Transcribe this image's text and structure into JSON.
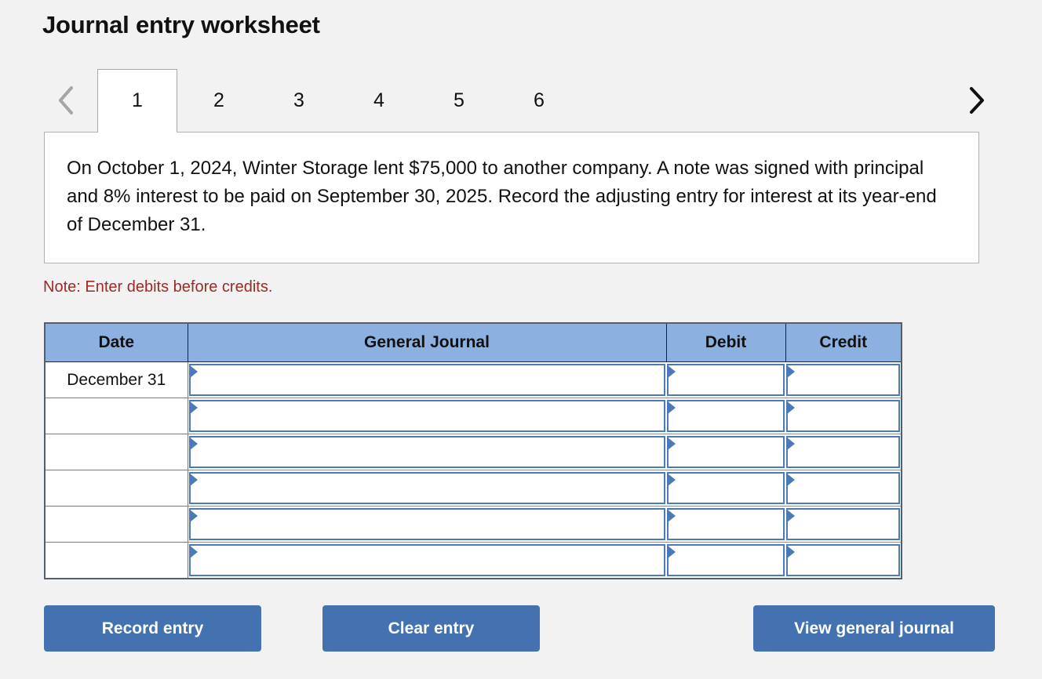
{
  "page": {
    "title": "Journal entry worksheet"
  },
  "tabs": {
    "prev_icon": "chevron-left-icon",
    "next_icon": "chevron-right-icon",
    "items": [
      {
        "label": "1",
        "active": true
      },
      {
        "label": "2",
        "active": false
      },
      {
        "label": "3",
        "active": false
      },
      {
        "label": "4",
        "active": false
      },
      {
        "label": "5",
        "active": false
      },
      {
        "label": "6",
        "active": false
      }
    ]
  },
  "question": {
    "text": "On October 1, 2024, Winter Storage lent $75,000 to another company. A note was signed with principal and 8% interest to be paid on September 30, 2025. Record the adjusting entry for interest at its year-end of December 31."
  },
  "note": {
    "text": "Note: Enter debits before credits.",
    "color": "#9d2a24"
  },
  "table": {
    "headers": [
      "Date",
      "General Journal",
      "Debit",
      "Credit"
    ],
    "header_bg": "#8cb0e0",
    "field_border": "#4a7ab8",
    "rows": [
      {
        "date": "December 31",
        "general_journal": "",
        "debit": "",
        "credit": ""
      },
      {
        "date": "",
        "general_journal": "",
        "debit": "",
        "credit": ""
      },
      {
        "date": "",
        "general_journal": "",
        "debit": "",
        "credit": ""
      },
      {
        "date": "",
        "general_journal": "",
        "debit": "",
        "credit": ""
      },
      {
        "date": "",
        "general_journal": "",
        "debit": "",
        "credit": ""
      },
      {
        "date": "",
        "general_journal": "",
        "debit": "",
        "credit": ""
      }
    ]
  },
  "buttons": {
    "record": "Record entry",
    "clear": "Clear entry",
    "view": "View general journal",
    "color": "#4472b0"
  }
}
